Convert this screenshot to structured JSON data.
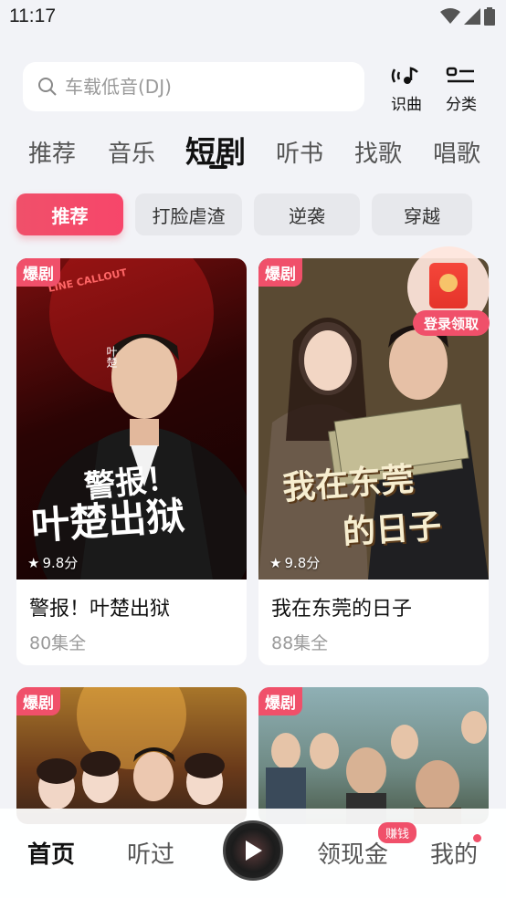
{
  "status": {
    "time": "11:17"
  },
  "search": {
    "placeholder": "车载低音(DJ)"
  },
  "tools": {
    "recognize": "识曲",
    "category": "分类"
  },
  "tabs": [
    {
      "label": "推荐"
    },
    {
      "label": "音乐"
    },
    {
      "label": "短剧"
    },
    {
      "label": "听书"
    },
    {
      "label": "找歌"
    },
    {
      "label": "唱歌"
    }
  ],
  "chips": [
    {
      "label": "推荐"
    },
    {
      "label": "打脸虐渣"
    },
    {
      "label": "逆袭"
    },
    {
      "label": "穿越"
    }
  ],
  "cards": [
    {
      "badge": "爆剧",
      "rating": "9.8分",
      "title": "警报！叶楚出狱",
      "episodes": "80集全",
      "poster_text_1": "警报！",
      "poster_text_2": "叶楚出狱",
      "poster_tag": "LINE CALLOUT",
      "poster_name": "叶楚"
    },
    {
      "badge": "爆剧",
      "rating": "9.8分",
      "title": "我在东莞的日子",
      "episodes": "88集全",
      "poster_text_1": "我在东莞",
      "poster_text_2": "的日子"
    },
    {
      "badge": "爆剧"
    },
    {
      "badge": "爆剧"
    }
  ],
  "redpacket": {
    "label": "登录领取"
  },
  "nav": {
    "home": "首页",
    "listened": "听过",
    "cash": "领现金",
    "cash_badge": "赚钱",
    "mine": "我的"
  },
  "colors": {
    "accent": "#f0506a",
    "background": "#f2f3f7"
  }
}
